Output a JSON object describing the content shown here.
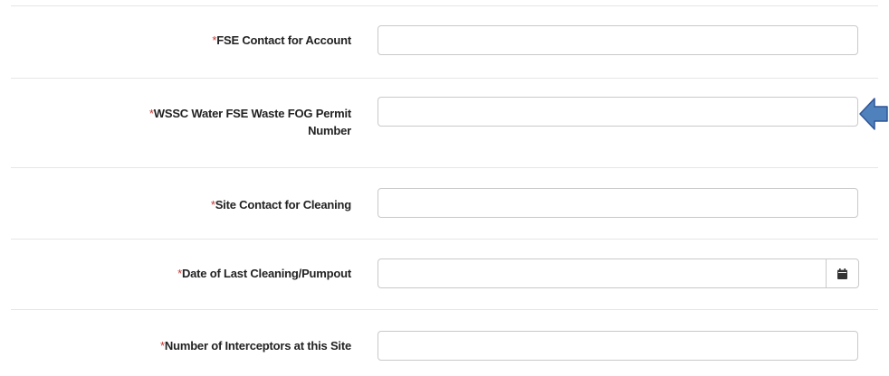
{
  "form": {
    "required_marker": "*",
    "fields": [
      {
        "label": "FSE Contact for Account",
        "value": ""
      },
      {
        "label_line1": "WSSC Water FSE Waste FOG Permit",
        "label_line2": "Number",
        "value": ""
      },
      {
        "label": "Site Contact for Cleaning",
        "value": ""
      },
      {
        "label": "Date of Last Cleaning/Pumpout",
        "value": ""
      },
      {
        "label": "Number of Interceptors at this Site",
        "value": ""
      }
    ]
  },
  "icons": {
    "calendar": "calendar-icon",
    "arrow": "left-arrow-icon"
  },
  "colors": {
    "required": "#c23934",
    "arrow_fill": "#4f81bd",
    "arrow_stroke": "#2f5597"
  }
}
